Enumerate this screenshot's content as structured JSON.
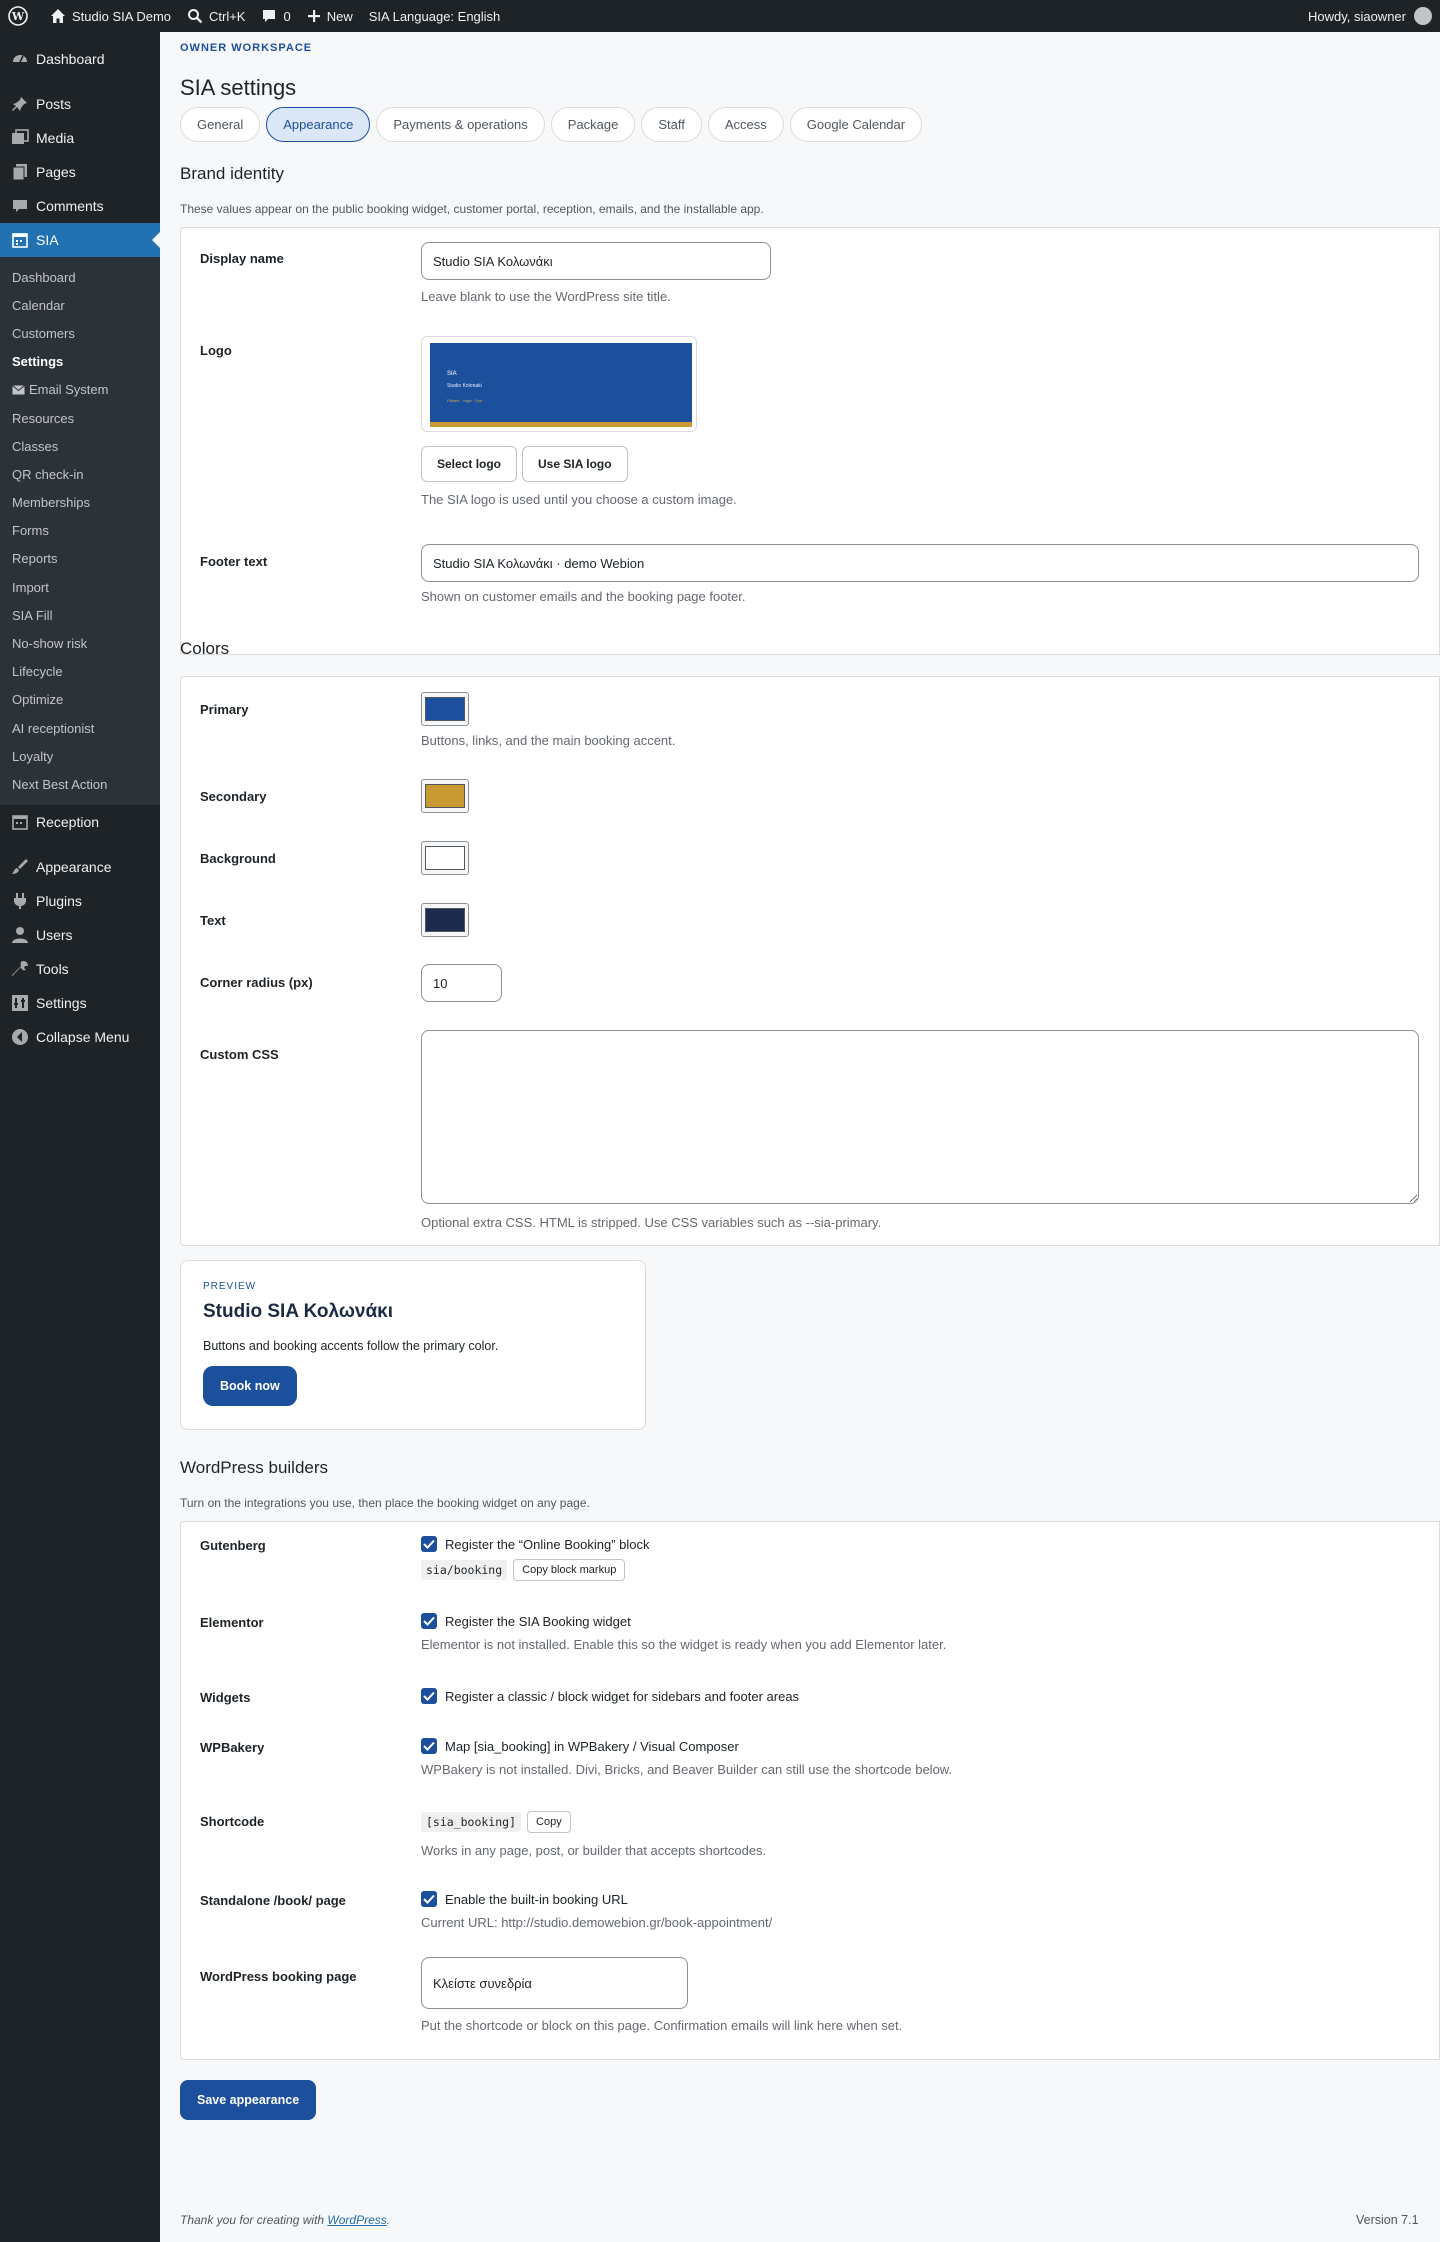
{
  "adminbar": {
    "site_name": "Studio SIA Demo",
    "search": "Ctrl+K",
    "comments_count": "0",
    "new_label": "New",
    "language": "SIA Language: English",
    "howdy": "Howdy, siaowner"
  },
  "sidebar": {
    "top_items": [
      "Dashboard",
      "Posts",
      "Media",
      "Pages",
      "Comments",
      "SIA"
    ],
    "sia_submenu": [
      "Dashboard",
      "Calendar",
      "Customers",
      "Settings",
      "Email System",
      "Resources",
      "Classes",
      "QR check-in",
      "Memberships",
      "Forms",
      "Reports",
      "Import",
      "SIA Fill",
      "No-show risk",
      "Lifecycle",
      "Optimize",
      "AI receptionist",
      "Loyalty",
      "Next Best Action"
    ],
    "reception": "Reception",
    "bottom_items": [
      "Appearance",
      "Plugins",
      "Users",
      "Tools",
      "Settings",
      "Collapse Menu"
    ]
  },
  "page": {
    "eyebrow": "OWNER WORKSPACE",
    "title": "SIA settings",
    "tabs": [
      "General",
      "Appearance",
      "Payments & operations",
      "Package",
      "Staff",
      "Access",
      "Google Calendar"
    ],
    "active_tab": "Appearance"
  },
  "brand": {
    "heading": "Brand identity",
    "description": "These values appear on the public booking widget, customer portal, reception, emails, and the installable app.",
    "display_name_label": "Display name",
    "display_name_value": "Studio SIA Κολωνάκι",
    "display_name_help": "Leave blank to use the WordPress site title.",
    "logo_label": "Logo",
    "logo_preview": {
      "line1": "SIA",
      "line2": "Studio Kolonaki",
      "line3": "Pilates · Yoga · Spa"
    },
    "select_logo": "Select logo",
    "use_sia_logo": "Use SIA logo",
    "logo_help": "The SIA logo is used until you choose a custom image.",
    "footer_label": "Footer text",
    "footer_value": "Studio SIA Κολωνάκι · demo Webion",
    "footer_help": "Shown on customer emails and the booking page footer."
  },
  "colors": {
    "heading": "Colors",
    "primary_label": "Primary",
    "primary_value": "#1c4f9c",
    "primary_help": "Buttons, links, and the main booking accent.",
    "secondary_label": "Secondary",
    "secondary_value": "#c99a33",
    "background_label": "Background",
    "background_value": "#ffffff",
    "text_label": "Text",
    "text_value": "#1d2a4d",
    "radius_label": "Corner radius (px)",
    "radius_value": "10",
    "css_label": "Custom CSS",
    "css_help": "Optional extra CSS. HTML is stripped. Use CSS variables such as --sia-primary."
  },
  "preview": {
    "eyebrow": "PREVIEW",
    "title": "Studio SIA Κολωνάκι",
    "description": "Buttons and booking accents follow the primary color.",
    "button": "Book now"
  },
  "builders": {
    "heading": "WordPress builders",
    "description": "Turn on the integrations you use, then place the booking widget on any page.",
    "gutenberg_label": "Gutenberg",
    "gutenberg_check": "Register the “Online Booking” block",
    "gutenberg_code": "sia/booking",
    "gutenberg_copy": "Copy block markup",
    "elementor_label": "Elementor",
    "elementor_check": "Register the SIA Booking widget",
    "elementor_help": "Elementor is not installed. Enable this so the widget is ready when you add Elementor later.",
    "widgets_label": "Widgets",
    "widgets_check": "Register a classic / block widget for sidebars and footer areas",
    "wpbakery_label": "WPBakery",
    "wpbakery_check": "Map [sia_booking] in WPBakery / Visual Composer",
    "wpbakery_help": "WPBakery is not installed. Divi, Bricks, and Beaver Builder can still use the shortcode below.",
    "shortcode_label": "Shortcode",
    "shortcode_code": "[sia_booking]",
    "shortcode_copy": "Copy",
    "shortcode_help": "Works in any page, post, or builder that accepts shortcodes.",
    "standalone_label": "Standalone /book/ page",
    "standalone_check": "Enable the built-in booking URL",
    "standalone_help": "Current URL: http://studio.demowebion.gr/book-appointment/",
    "booking_page_label": "WordPress booking page",
    "booking_page_value": "Κλείστε συνεδρία",
    "booking_page_help": "Put the shortcode or block on this page. Confirmation emails will link here when set."
  },
  "save_button": "Save appearance",
  "footer": {
    "thanks_prefix": "Thank you for creating with ",
    "thanks_link": "WordPress",
    "thanks_suffix": ".",
    "version": "Version 7.1"
  }
}
